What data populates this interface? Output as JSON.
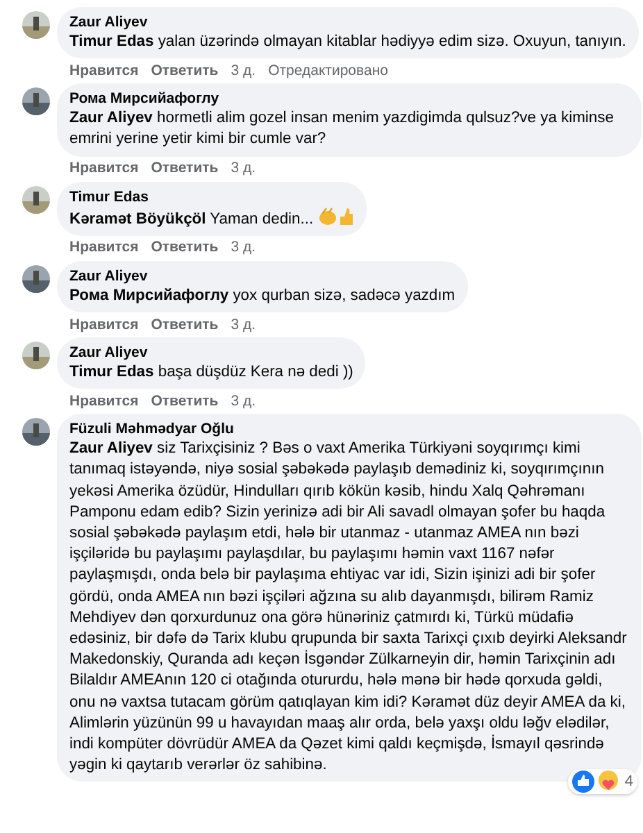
{
  "comments": [
    {
      "author": "Zaur Aliyev",
      "text": "**Timur Edas** yalan üzərində olmayan kitablar hədiyyə edim sizə. Oxuyun, tanıyın.",
      "actions": [
        "Нравится",
        "Ответить"
      ],
      "time": "3 д.",
      "edited": "Отредактировано"
    },
    {
      "author": "Рома Мирсийафоглу",
      "text": "**Zaur Aliyev** hormetli alim gozel insan menim yazdigimda qulsuz?ve ya kiminse emrini yerine yetir kimi bir cumle var?",
      "actions": [
        "Нравится",
        "Ответить"
      ],
      "time": "3 д."
    },
    {
      "author": "Timur Edas",
      "text": "**Kəramət Böyükçöl** Yaman dedin...",
      "emojis": [
        {
          "kind": "clap"
        },
        {
          "kind": "thumbs_up"
        }
      ],
      "actions": [
        "Нравится",
        "Ответить"
      ],
      "time": "3 д."
    },
    {
      "author": "Zaur Aliyev",
      "text": "**Рома Мирсийафоглу** yox qurban sizə, sadəcə yazdım",
      "actions": [
        "Нравится",
        "Ответить"
      ],
      "time": "3 д."
    },
    {
      "author": "Zaur Aliyev",
      "text": "**Timur Edas** başa düşdüz Kera nə dedi ))",
      "actions": [
        "Нравится",
        "Ответить"
      ],
      "time": "3 д."
    },
    {
      "author": "Füzuli Məhmədyar Oğlu",
      "text": "**Zaur Aliyev** siz Tarixçisiniz ? Bəs o vaxt Amerika Türkiyəni soyqırımçı kimi tanımaq istəyəndə, niyə sosial şəbəkədə paylaşıb demədiniz ki, soyqırımçının yekəsi Amerika özüdür, Hindulları qırıb kökün kəsib, hindu Xalq Qəhrəmanı Pamponu edam edib? Sizin yerinizə adi bir Ali savadl olmayan şofer bu haqda sosial şəbəkədə paylaşım etdi, hələ bir utanmaz - utanmaz AMEA nın bəzi işçiləridə bu paylaşımı paylaşdılar, bu paylaşımı həmin vaxt 1167 nəfər paylaşmışdı, onda belə bir paylaşıma ehtiyac var idi, Sizin işinizi adi bir şofer gördü, onda AMEA nın bəzi işçiləri ağzına su alıb dayanmışdı, bilirəm Ramiz Mehdiyev dən qorxurdunuz ona görə hünəriniz çatmırdı ki, Türkü müdafiə edəsiniz, bir dəfə də Tarix klubu qrupunda bir saxta Tarixçi çıxıb deyirki Aleksandr Makedonskiy, Quranda adı keçən İsgəndər Zülkarneyin dir, həmin Tarixçinin adı Bilaldır AMEAnın 120 ci otağında otururdu, hələ mənə bir hədə qorxuda gəldi, onu nə vaxtsa tutacam görüm qatıqlayan kim idi? Kəramət düz deyir AMEA da ki, Alimlərin yüzünün 99 u havayıdan maaş alır orda, belə yaxşı oldu ləğv elədilər, indi kompüter dövrüdür AMEA da Qəzet kimi qaldı keçmişdə, İsmayıl qəsrində yəgin ki qaytarıb verərlər öz sahibinə.",
      "reactions": {
        "icons": [
          {
            "kind": "like"
          },
          {
            "kind": "care"
          }
        ],
        "count": "4"
      }
    }
  ]
}
